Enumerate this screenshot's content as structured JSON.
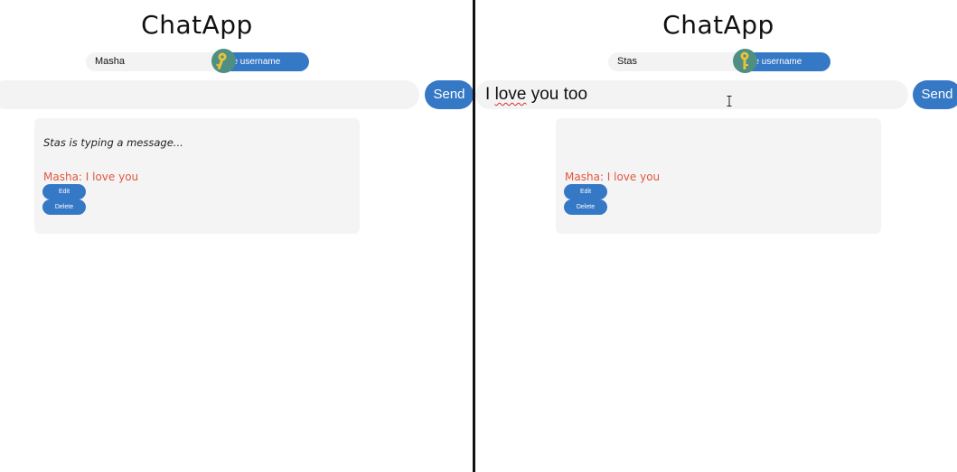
{
  "left": {
    "title": "ChatApp",
    "username_value": "Masha",
    "change_button_label": "Change username",
    "message_value": "",
    "send_label": "Send",
    "typing_indicator": "Stas is typing a message...",
    "message": {
      "text": "Masha: I love you",
      "edit_label": "Edit",
      "delete_label": "Delete"
    }
  },
  "right": {
    "title": "ChatApp",
    "username_value": "Stas",
    "change_button_label": "Change username",
    "message_value": "I love you too",
    "message_words": [
      "I",
      "love",
      "you",
      "too"
    ],
    "send_label": "Send",
    "message": {
      "text": "Masha: I love you",
      "edit_label": "Edit",
      "delete_label": "Delete"
    }
  },
  "icons": {
    "key": "key-icon",
    "cursor": "text-cursor-icon"
  },
  "colors": {
    "accent": "#3478c6",
    "message_text": "#e0573e",
    "panel": "#f4f4f4",
    "key_badge": "#4f8f83",
    "key_color": "#e8c23a"
  }
}
